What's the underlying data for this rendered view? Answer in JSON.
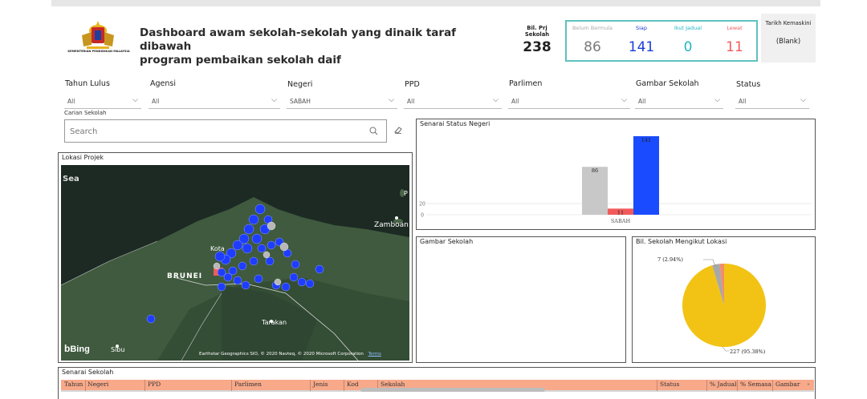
{
  "header": {
    "ministry": "KEMENTERIAN PENDIDIKAN MALAYSIA",
    "title_line1": "Dashboard awam sekolah-sekolah yang dinaik taraf dibawah",
    "title_line2": "program pembaikan sekolah daif",
    "bil_label": "Bil. Prj Sekolah",
    "bil_value": "238",
    "statuses": [
      {
        "label": "Belum Bermula",
        "value": "86",
        "color": "#c8c8c8",
        "value_color": "#7a7a7a"
      },
      {
        "label": "Siap",
        "value": "141",
        "color": "#1a4bff",
        "value_color": "#1a3fd6"
      },
      {
        "label": "Ikut Jadual",
        "value": "0",
        "color": "#22b5c4",
        "value_color": "#22b5c4"
      },
      {
        "label": "Lewat",
        "value": "11",
        "color": "#f25b5b",
        "value_color": "#f25b5b"
      }
    ],
    "tarikh_label": "Tarikh Kemaskini",
    "tarikh_value": "(Blank)"
  },
  "filters": [
    {
      "label": "Tahun Lulus",
      "value": "All"
    },
    {
      "label": "Agensi",
      "value": "All"
    },
    {
      "label": "Negeri",
      "value": "SABAH"
    },
    {
      "label": "PPD",
      "value": "All"
    },
    {
      "label": "Parlimen",
      "value": "All"
    },
    {
      "label": "Gambar Sekolah",
      "value": "All"
    },
    {
      "label": "Status",
      "value": "All"
    }
  ],
  "search": {
    "label": "Carian Sekolah",
    "placeholder": "Search"
  },
  "map": {
    "title": "Lokasi Projek",
    "labels": {
      "sea": "Sea",
      "brunei": "BRUNEI",
      "kota": "Kota",
      "zamboanga": "Zamboan",
      "tarakan": "Tarakan",
      "sibu": "Sibu",
      "p": "P"
    },
    "bing": "Bing",
    "copyright": "Earthstar Geographics SIO, © 2020 Navteq, © 2020 Microsoft Corporation",
    "terms": "Terms"
  },
  "status_chart": {
    "title": "Senarai Status Negeri"
  },
  "gambar": {
    "title": "Gambar Sekolah"
  },
  "pie_panel": {
    "title": "Bil. Sekolah Mengikut Lokasi"
  },
  "table": {
    "title": "Senarai Sekolah",
    "columns": [
      "Tahun",
      "Negeri",
      "PPD",
      "Parlimen",
      "Jenis",
      "Kod",
      "Sekolah",
      "Status",
      "% Jadual",
      "% Semasa",
      "Gambar"
    ]
  },
  "chart_data": [
    {
      "type": "bar",
      "stacked": false,
      "categories": [
        "SABAH"
      ],
      "series": [
        {
          "values": [
            86
          ],
          "color": "#c8c8c8"
        },
        {
          "values": [
            11
          ],
          "color": "#f25b5b"
        },
        {
          "values": [
            141
          ],
          "color": "#1a4bff"
        }
      ],
      "data_labels": [
        "86",
        "11",
        "141"
      ],
      "y_ticks": [
        0,
        20
      ],
      "grid": true,
      "legend": "none"
    },
    {
      "type": "pie",
      "slices": [
        {
          "value": 227,
          "label": "227 (95.38%)",
          "color": "#f2c314"
        },
        {
          "value": 7,
          "label": "7 (2.94%)",
          "color": "#a8a8a8"
        },
        {
          "value": 4,
          "label": "",
          "color": "#f28c6a"
        }
      ],
      "legend": "none"
    }
  ]
}
